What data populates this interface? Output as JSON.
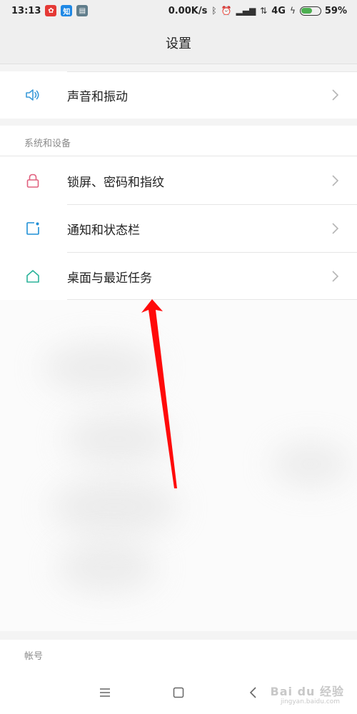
{
  "status_bar": {
    "time": "13:13",
    "app_icons": [
      "weibo-icon",
      "zhihu-icon",
      "app-icon"
    ],
    "zhihu_label": "知",
    "net_speed": "0.00K/s",
    "network": "4G",
    "battery_percent": "59%",
    "battery_level": 0.59
  },
  "header": {
    "title": "设置"
  },
  "rows": {
    "sound": {
      "label": "声音和振动",
      "icon": "speaker-icon"
    },
    "lock": {
      "label": "锁屏、密码和指纹",
      "icon": "lock-icon"
    },
    "notify": {
      "label": "通知和状态栏",
      "icon": "notification-icon"
    },
    "home": {
      "label": "桌面与最近任务",
      "icon": "home-icon"
    }
  },
  "sections": {
    "system": "系统和设备",
    "account": "帐号"
  },
  "nav": {
    "menu": "menu-icon",
    "home": "home-square-icon",
    "back": "back-icon"
  },
  "watermark": {
    "brand": "Bai du 经验",
    "sub": "jingyan.baidu.com"
  },
  "colors": {
    "speaker": "#3a9ad9",
    "lock": "#e0607e",
    "notify": "#1f8fd6",
    "home": "#2bb39a",
    "arrow": "#ff0a0a"
  }
}
